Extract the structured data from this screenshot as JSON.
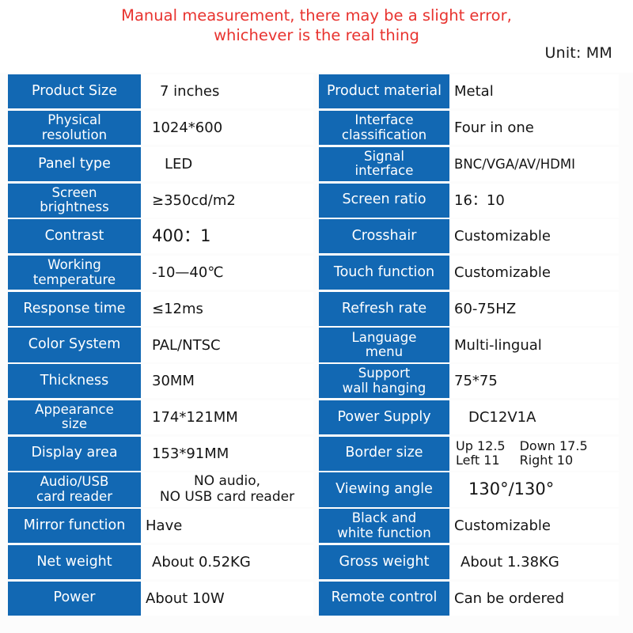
{
  "header": {
    "notice_line1": "Manual measurement, there may be a slight error,",
    "notice_line2": "whichever is the real thing",
    "unit": "Unit: MM",
    "notice_color": "#e8332f"
  },
  "theme": {
    "label_bg": "#1268b3",
    "label_text": "#ffffff",
    "value_text": "#151515",
    "page_bg": "#fcfcfc"
  },
  "spec_rows": [
    {
      "left_label": "Product Size",
      "left_value": "7 inches",
      "right_label": "Product material",
      "right_value": "Metal"
    },
    {
      "left_label_line1": "Physical",
      "left_label_line2": "resolution",
      "left_value": "1024*600",
      "right_label_line1": "Interface",
      "right_label_line2": "classification",
      "right_value": "Four in one"
    },
    {
      "left_label": "Panel type",
      "left_value": "LED",
      "right_label_line1": "Signal",
      "right_label_line2": "interface",
      "right_value": "BNC/VGA/AV/HDMI"
    },
    {
      "left_label_line1": "Screen",
      "left_label_line2": "brightness",
      "left_value": "≥350cd/m2",
      "right_label": "Screen ratio",
      "right_value": "16：10"
    },
    {
      "left_label": "Contrast",
      "left_value": "400：1",
      "right_label": "Crosshair",
      "right_value": "Customizable"
    },
    {
      "left_label_line1": "Working",
      "left_label_line2": "temperature",
      "left_value": "-10—40℃",
      "right_label": "Touch function",
      "right_value": "Customizable"
    },
    {
      "left_label": "Response time",
      "left_value": "≤12ms",
      "right_label": "Refresh rate",
      "right_value": "60-75HZ"
    },
    {
      "left_label": "Color System",
      "left_value": "PAL/NTSC",
      "right_label_line1": "Language",
      "right_label_line2": "menu",
      "right_value": "Multi-lingual"
    },
    {
      "left_label": "Thickness",
      "left_value": "30MM",
      "right_label_line1": "Support",
      "right_label_line2": "wall hanging",
      "right_value": "75*75"
    },
    {
      "left_label_line1": "Appearance",
      "left_label_line2": "size",
      "left_value": "174*121MM",
      "right_label": "Power Supply",
      "right_value": "DC12V1A"
    },
    {
      "left_label": "Display area",
      "left_value": "153*91MM",
      "right_label": "Border size",
      "right_value_cells": [
        "Up 12.5",
        "Down 17.5",
        "Left 11",
        "Right 10"
      ]
    },
    {
      "left_label_line1": "Audio/USB",
      "left_label_line2": "card reader",
      "left_value_line1": "NO audio,",
      "left_value_line2": "NO USB card reader",
      "right_label": "Viewing angle",
      "right_value": "130°/130°"
    },
    {
      "left_label": "Mirror function",
      "left_value": "Have",
      "right_label_line1": "Black and",
      "right_label_line2": "white function",
      "right_value": "Customizable"
    },
    {
      "left_label": "Net weight",
      "left_value": "About 0.52KG",
      "right_label": "Gross weight",
      "right_value": "About 1.38KG"
    },
    {
      "left_label": "Power",
      "left_value": "About 10W",
      "right_label": "Remote control",
      "right_value": "Can be ordered"
    }
  ]
}
